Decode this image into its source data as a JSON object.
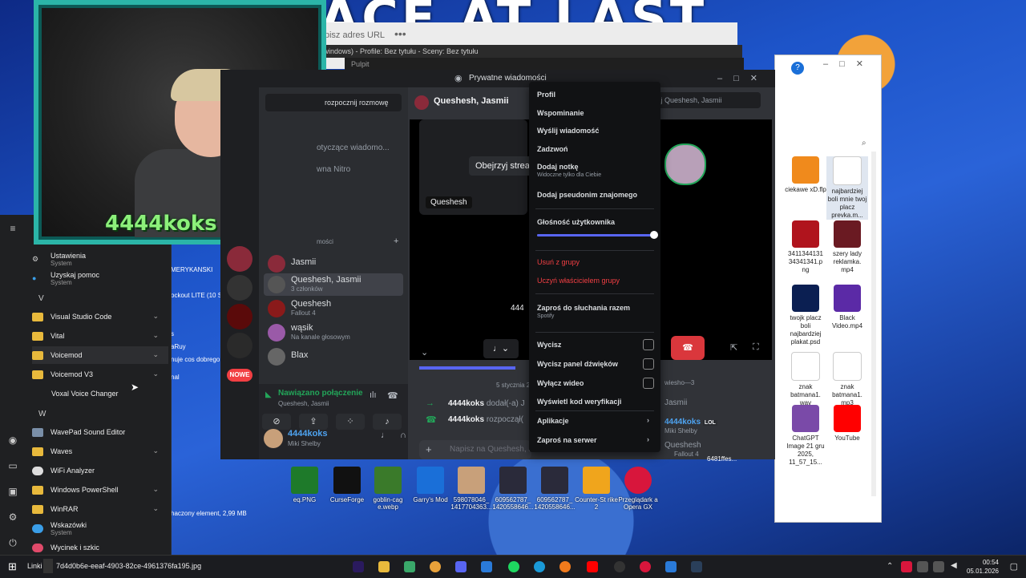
{
  "banner": {
    "text": "FACE AT LAST"
  },
  "browser": {
    "url_placeholder": "e lub wpisz adres URL",
    "dots": "•••"
  },
  "obs": {
    "title": "t, windows) - Profile: Bez tytułu - Sceny: Bez tytułu",
    "pulpit": "Pulpit"
  },
  "webcam": {
    "overlay_name": "4444koks"
  },
  "start_menu": {
    "top_items": [
      {
        "label": "Ustawienia",
        "sub": "System",
        "icon": "gear-icon"
      },
      {
        "label": "Uzyskaj pomoc",
        "sub": "System",
        "icon": "help-icon"
      }
    ],
    "letters": {
      "v": "V",
      "w": "W"
    },
    "v_items": [
      {
        "label": "Visual Studio Code",
        "chevron": "⌄"
      },
      {
        "label": "Vital",
        "chevron": "⌄"
      },
      {
        "label": "Voicemod",
        "chevron": "⌄"
      },
      {
        "label": "Voicemod V3",
        "chevron": "⌄"
      },
      {
        "label": "Voxal Voice Changer",
        "chevron": ""
      }
    ],
    "w_items": [
      {
        "label": "WavePad Sound Editor",
        "chevron": ""
      },
      {
        "label": "Waves",
        "chevron": "⌄"
      },
      {
        "label": "WiFi Analyzer",
        "chevron": ""
      },
      {
        "label": "Windows PowerShell",
        "chevron": "⌄"
      },
      {
        "label": "WinRAR",
        "chevron": "⌄"
      },
      {
        "label": "Wskazówki",
        "sub": "System",
        "chevron": ""
      },
      {
        "label": "Wycinek i szkic",
        "chevron": ""
      }
    ]
  },
  "background_fragments": {
    "amerykanski": "MERYKANSKI",
    "lockout": "ockout LITE (10 Se",
    "s": "s",
    "ruy": "aRuy",
    "dobrego": "nuje cos dobrego",
    "nal": "nal",
    "status": "haczony element, 2,99 MB"
  },
  "discord": {
    "window_title": "Prywatne wiadomości",
    "start_conversation": "rozpocznij rozmowę",
    "dm_fragment_1": "otyczące wiadomo...",
    "dm_fragment_2": "wna Nitro",
    "dm_header_fragment": "mości",
    "dm_list": [
      {
        "name": "Jasmii",
        "status": ""
      },
      {
        "name": "Queshesh, Jasmii",
        "status": "3 członków"
      },
      {
        "name": "Queshesh",
        "status": "Fallout 4"
      },
      {
        "name": "wąsik",
        "status": "Na kanale głosowym"
      },
      {
        "name": "Blax",
        "status": ""
      }
    ],
    "new_badge": "NOWE",
    "voice": {
      "connected": "Nawiązano połączenie",
      "channel": "Queshesh, Jasmii"
    },
    "user": {
      "name": "4444koks",
      "status": "Miki Shelby"
    },
    "chat_header": "Queshesh, Jasmii",
    "search_placeholder": "kaj Queshesh, Jasmii",
    "watch_stream": "Obejrzyj stream",
    "stream_label": "Queshesh",
    "date_divider": "5 stycznia 2",
    "messages": [
      {
        "author": "4444koks",
        "text": "dodał(-a) J"
      },
      {
        "author": "4444koks",
        "text": "rozpoczął("
      }
    ],
    "input_placeholder": "Napisz na Queshesh, J",
    "stream_time": "444",
    "members_header": "wiesho—3",
    "members": [
      {
        "name": "Jasmii",
        "status": ""
      },
      {
        "name": "4444koks",
        "badge": "LOL",
        "status": "Miki Shelby"
      },
      {
        "name": "Queshesh",
        "status": "Fallout 4"
      }
    ]
  },
  "context_menu": {
    "items": [
      {
        "label": "Profil"
      },
      {
        "label": "Wspominanie"
      },
      {
        "label": "Wyślij wiadomość"
      },
      {
        "label": "Zadzwoń"
      },
      {
        "label": "Dodaj notkę",
        "sub": "Widoczne tylko dla Ciebie"
      },
      {
        "label": "Dodaj pseudonim znajomego"
      },
      {
        "label": "Głośność użytkownika"
      },
      {
        "label": "Usuń z grupy"
      },
      {
        "label": "Uczyń właścicielem grupy"
      },
      {
        "label": "Zaproś do słuchania razem",
        "sub": "Spotify"
      },
      {
        "label": "Wycisz"
      },
      {
        "label": "Wycisz panel dźwięków"
      },
      {
        "label": "Wyłącz wideo"
      },
      {
        "label": "Wyświetl kod weryfikacji"
      },
      {
        "label": "Aplikacje"
      },
      {
        "label": "Zaproś na serwer"
      }
    ],
    "volume_fraction": 1.0
  },
  "explorer_files": [
    {
      "label": "ciekawe xD.flp",
      "color": "#f08a1c"
    },
    {
      "label": "najbardziej boli mnie twoj placz prevka.m...",
      "color": "#ffffff"
    },
    {
      "label": "3411344131 34341341.p ng",
      "color": "#b0141d"
    },
    {
      "label": "szery lady reklamka. mp4",
      "color": "#6a1a22"
    },
    {
      "label": "twojk placz boli najbardziej plakat.psd",
      "color": "#0b1f52"
    },
    {
      "label": "Black Video.mp4",
      "color": "#5b2aa6"
    },
    {
      "label": "znak batmana1. wav",
      "color": "#ffffff"
    },
    {
      "label": "znak batmana1. mp3",
      "color": "#ffffff"
    },
    {
      "label": "ChatGPT Image 21 gru 2025, 11_57_15...",
      "color": "#7a4aa8"
    },
    {
      "label": "YouTube",
      "color": "#ff0000"
    }
  ],
  "desktop_icons": [
    {
      "label": "eq.PNG",
      "color": "#1e7a2a"
    },
    {
      "label": "CurseForge",
      "color": "#111111"
    },
    {
      "label": "goblin-cag e.webp",
      "color": "#3a7a2a"
    },
    {
      "label": "Garry's Mod",
      "color": "#1a6fd8"
    },
    {
      "label": "598078046_ 1417704363...",
      "color": "#c8a07a"
    },
    {
      "label": "609562787_ 1420558646...",
      "color": "#2a2a3a"
    },
    {
      "label": "609562787_ 1420558646...",
      "color": "#2a2a3a"
    },
    {
      "label": "Counter-St rike 2",
      "color": "#f0a51c"
    },
    {
      "label": "Przeglądark a Opera GX",
      "color": "#d8163c"
    }
  ],
  "explorer_fragment": "6481ffes...",
  "taskbar": {
    "links_label": "Linki",
    "file_label": "7d4d0b6e-eeaf-4903-82ce-4961376fa195.jpg",
    "time": "00:54",
    "date": "05.01.2026",
    "icons": [
      "premiere-icon",
      "folder-icon",
      "vpn-icon",
      "chrome-icon",
      "discord-icon",
      "store-icon",
      "spotify-icon",
      "edge-icon",
      "firefox-icon",
      "youtube-icon",
      "recorder-icon",
      "opera-icon",
      "mail-icon",
      "steam-icon"
    ]
  }
}
